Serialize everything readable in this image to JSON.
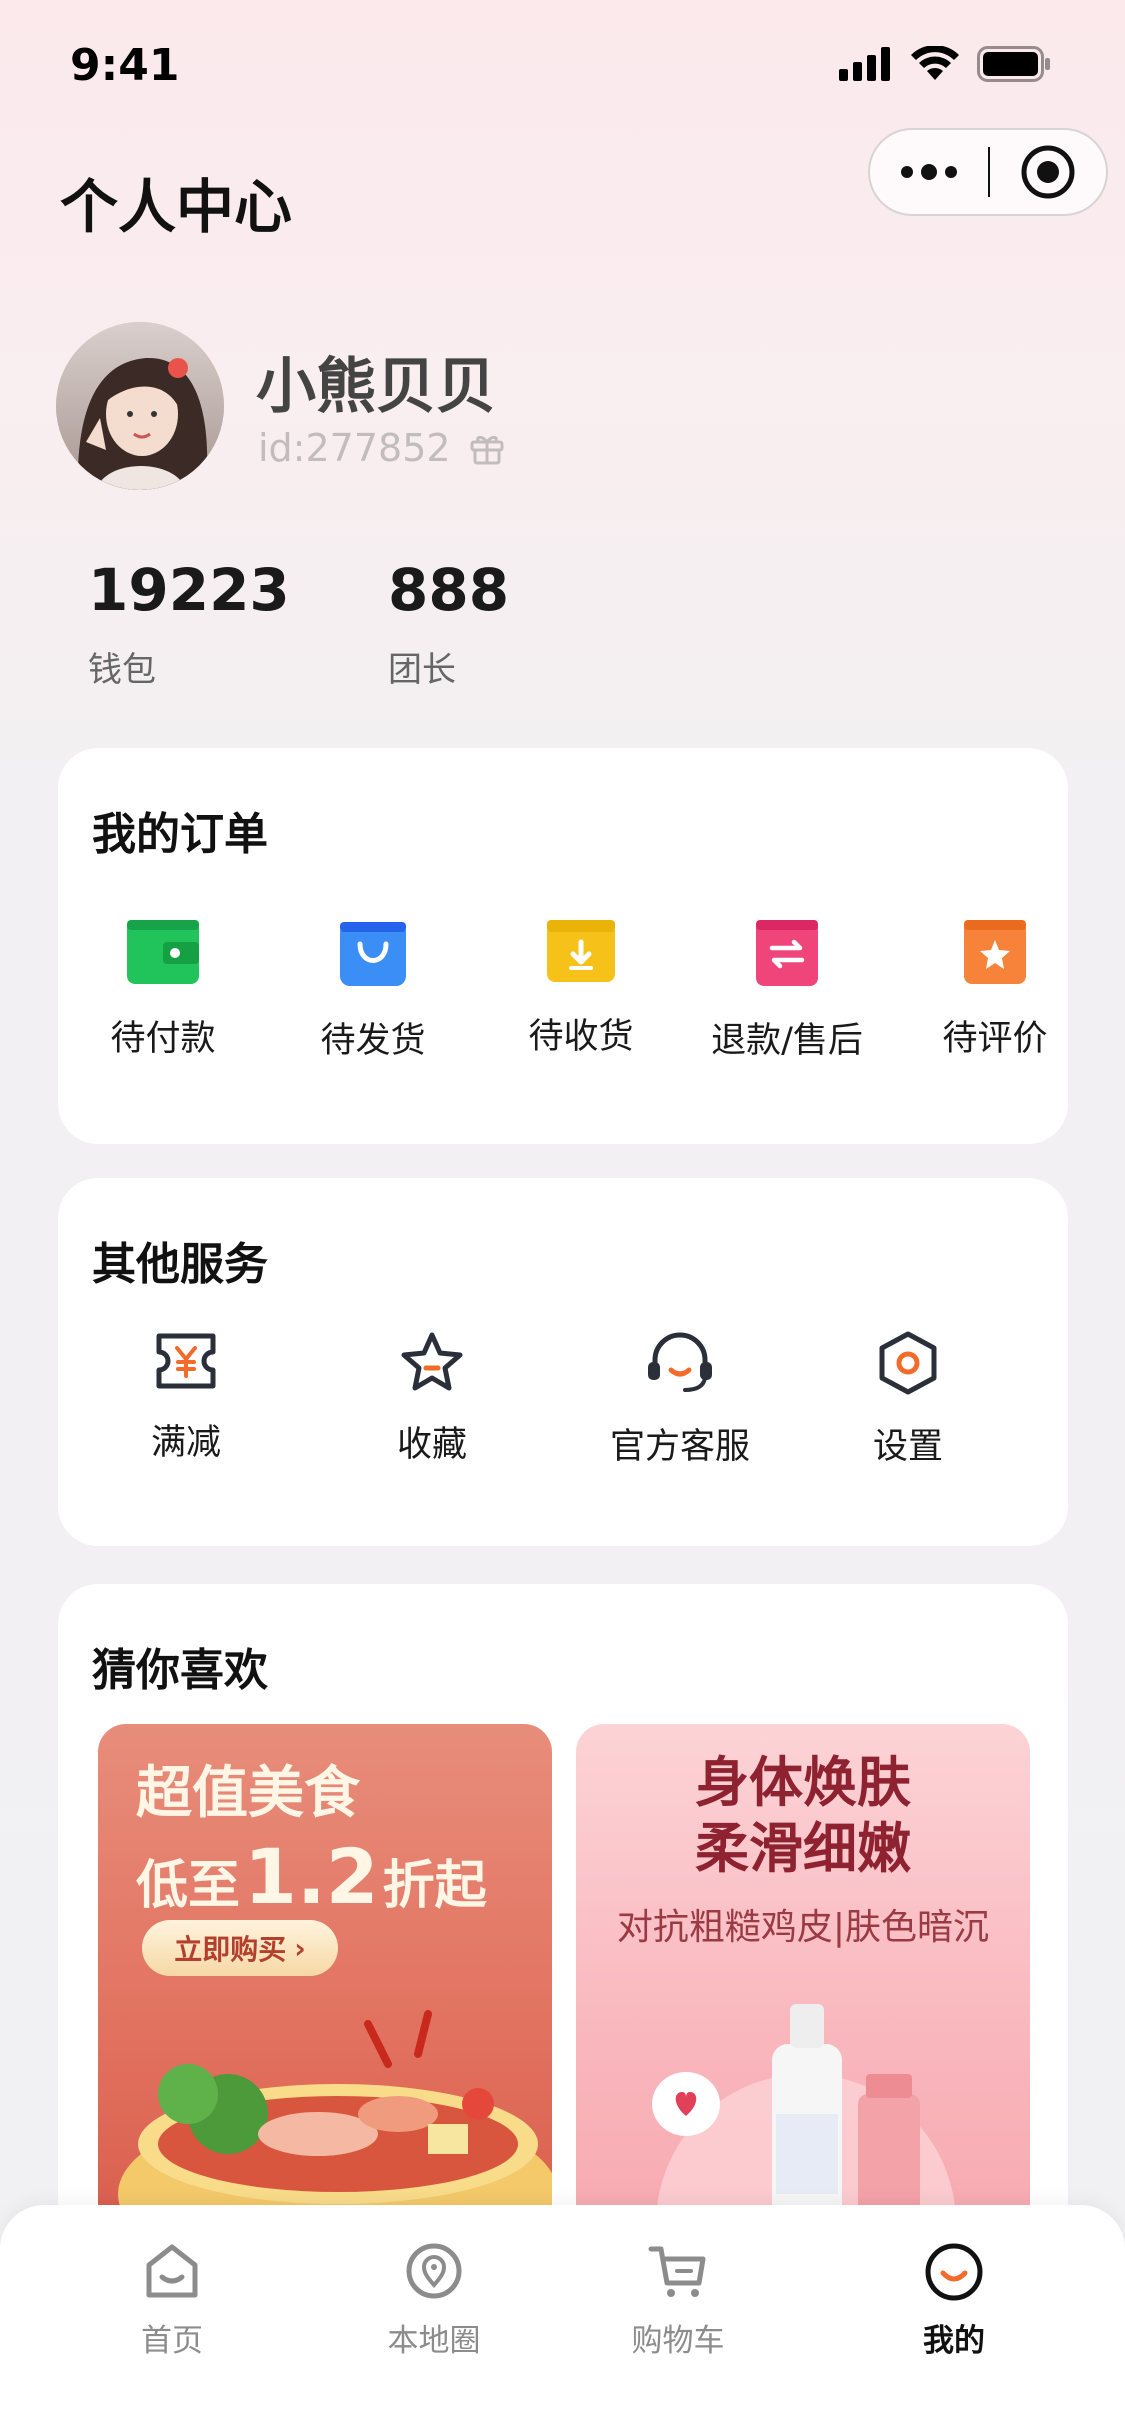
{
  "status_bar": {
    "time": "9:41"
  },
  "header": {
    "title": "个人中心"
  },
  "profile": {
    "name": "小熊贝贝",
    "id_text": "id:277852"
  },
  "stats": [
    {
      "value": "19223",
      "label": "钱包"
    },
    {
      "value": "888",
      "label": "团长"
    }
  ],
  "orders": {
    "title": "我的订单",
    "items": [
      {
        "label": "待付款",
        "icon": "wallet-icon",
        "color": "#22c55e"
      },
      {
        "label": "待发货",
        "icon": "shopping-bag-icon",
        "color": "#3b8ef5"
      },
      {
        "label": "待收货",
        "icon": "box-download-icon",
        "color": "#f5c518"
      },
      {
        "label": "退款/售后",
        "icon": "refund-exchange-icon",
        "color": "#f0457a"
      },
      {
        "label": "待评价",
        "icon": "star-review-icon",
        "color": "#f7833a"
      }
    ]
  },
  "services": {
    "title": "其他服务",
    "items": [
      {
        "label": "满减",
        "icon": "coupon-icon"
      },
      {
        "label": "收藏",
        "icon": "favorite-star-icon"
      },
      {
        "label": "官方客服",
        "icon": "headset-icon"
      },
      {
        "label": "设置",
        "icon": "settings-icon"
      }
    ]
  },
  "recommend": {
    "title": "猜你喜欢",
    "banners": [
      {
        "line1": "超值美食",
        "line2_prefix": "低至",
        "line2_number": "1.2",
        "line2_suffix": "折起",
        "button": "立即购买"
      },
      {
        "line1": "身体焕肤",
        "line2": "柔滑细嫩",
        "subtitle": "对抗粗糙鸡皮|肤色暗沉"
      }
    ]
  },
  "tabbar": {
    "items": [
      {
        "label": "首页",
        "icon": "home-icon",
        "active": false
      },
      {
        "label": "本地圈",
        "icon": "location-icon",
        "active": false
      },
      {
        "label": "购物车",
        "icon": "cart-icon",
        "active": false
      },
      {
        "label": "我的",
        "icon": "profile-smile-icon",
        "active": true
      }
    ]
  },
  "colors": {
    "accent": "#f26b2a",
    "icon_dark": "#2a2f3a"
  }
}
